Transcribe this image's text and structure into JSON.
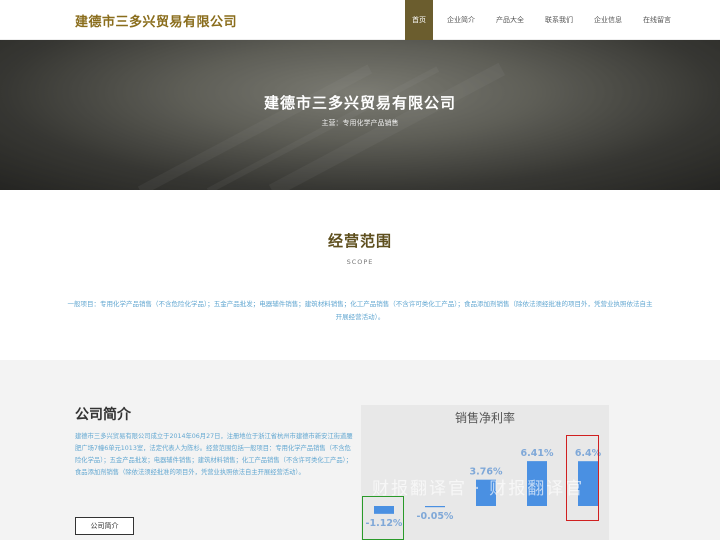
{
  "header": {
    "logo": "建德市三多兴贸易有限公司",
    "nav": [
      "首页",
      "企业简介",
      "产品大全",
      "联系我们",
      "企业信息",
      "在线留言"
    ]
  },
  "hero": {
    "title": "建德市三多兴贸易有限公司",
    "subtitle": "主营：专用化学产品销售"
  },
  "scope": {
    "title": "经营范围",
    "subtitle": "SCOPE",
    "text": "一般项目：专用化学产品销售（不含危险化学品）；五金产品批发；电器辅件销售；建筑材料销售；化工产品销售（不含许可类化工产品）；食品添加剂销售（除依法须经批准的项目外，凭营业执照依法自主开展经营活动）。"
  },
  "about": {
    "title": "公司简介",
    "text": "建德市三多兴贸易有限公司成立于2014年06月27日，注册地位于浙江省杭州市建德市新安江街道腰肥广场7幢6单元1013室，法定代表人为陈杉。经营范围包括一般项目：专用化学产品销售（不含危险化学品）；五金产品批发；电器辅件销售；建筑材料销售；化工产品销售（不含许可类化工产品）；食品添加剂销售（除依法须经批准的项目外，凭营业执照依法自主开展经营活动）。",
    "button": "公司简介"
  },
  "chart_data": {
    "type": "bar",
    "title": "销售净利率",
    "values": [
      -1.12,
      -0.05,
      3.76,
      6.41,
      6.4
    ],
    "labels": [
      "-1.12%",
      "-0.05%",
      "3.76%",
      "6.41%",
      "6.4%"
    ],
    "ylim": [
      -2.5,
      8
    ],
    "bar_color": "#4a90e2",
    "label_color": "#7fa8d8"
  },
  "watermark": "财报翻译官 · 财报翻译官"
}
